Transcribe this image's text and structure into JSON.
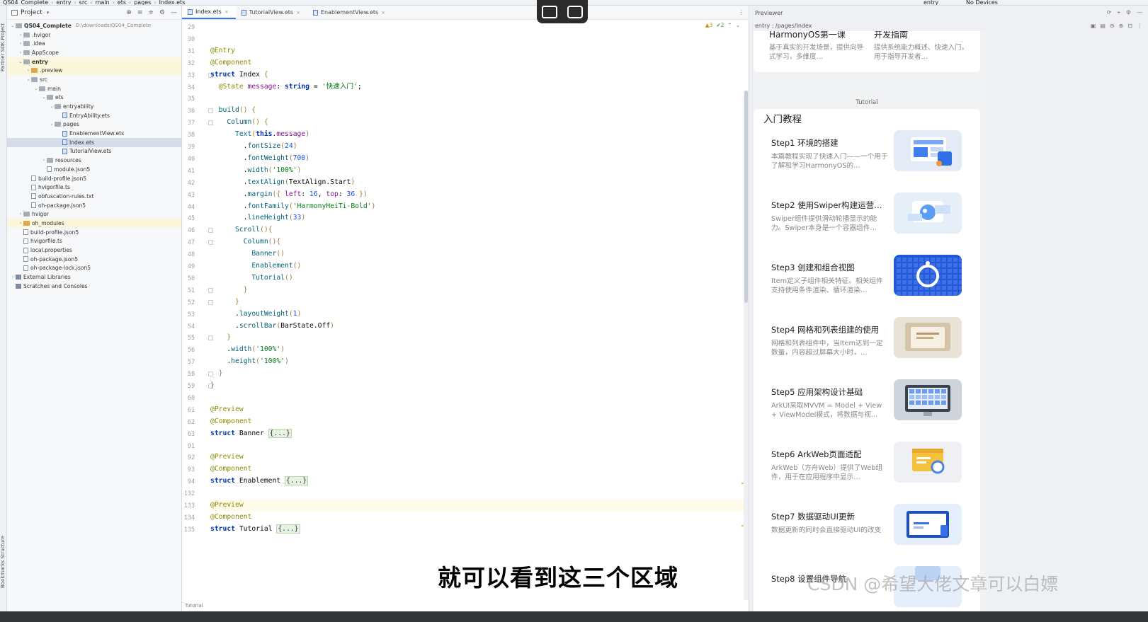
{
  "breadcrumb": [
    "QS04_Complete",
    "entry",
    "src",
    "main",
    "ets",
    "pages",
    "Index.ets"
  ],
  "run_config": {
    "module": "entry",
    "devices": "No Devices"
  },
  "left_strip": {
    "top": "Partner SDK  Project",
    "bottom": "Bookmarks  Structure"
  },
  "project_panel": {
    "title": "Project",
    "tree": [
      {
        "label": "QS04_Complete",
        "hint": "D:\\downloads\\QS04_Complete",
        "depth": 0,
        "arrow": "v",
        "icon": "folder",
        "bold": true
      },
      {
        "label": ".hvigor",
        "depth": 1,
        "arrow": ">",
        "icon": "folder"
      },
      {
        "label": ".idea",
        "depth": 1,
        "arrow": ">",
        "icon": "folder"
      },
      {
        "label": "AppScope",
        "depth": 1,
        "arrow": ">",
        "icon": "folder"
      },
      {
        "label": "entry",
        "depth": 1,
        "arrow": "v",
        "icon": "folder",
        "bold": true,
        "hl": true
      },
      {
        "label": ".preview",
        "depth": 2,
        "arrow": ">",
        "icon": "folder-orange",
        "hl": true
      },
      {
        "label": "src",
        "depth": 2,
        "arrow": "v",
        "icon": "folder"
      },
      {
        "label": "main",
        "depth": 3,
        "arrow": "v",
        "icon": "folder"
      },
      {
        "label": "ets",
        "depth": 4,
        "arrow": "v",
        "icon": "folder"
      },
      {
        "label": "entryability",
        "depth": 5,
        "arrow": "v",
        "icon": "folder"
      },
      {
        "label": "EntryAbility.ets",
        "depth": 6,
        "arrow": "",
        "icon": "ets"
      },
      {
        "label": "pages",
        "depth": 5,
        "arrow": "v",
        "icon": "folder"
      },
      {
        "label": "EnablementView.ets",
        "depth": 6,
        "arrow": "",
        "icon": "ets"
      },
      {
        "label": "Index.ets",
        "depth": 6,
        "arrow": "",
        "icon": "ets",
        "sel": true
      },
      {
        "label": "TutorialView.ets",
        "depth": 6,
        "arrow": "",
        "icon": "ets"
      },
      {
        "label": "resources",
        "depth": 4,
        "arrow": ">",
        "icon": "folder"
      },
      {
        "label": "module.json5",
        "depth": 4,
        "arrow": "",
        "icon": "file"
      },
      {
        "label": "build-profile.json5",
        "depth": 2,
        "arrow": "",
        "icon": "file"
      },
      {
        "label": "hvigorfile.ts",
        "depth": 2,
        "arrow": "",
        "icon": "file"
      },
      {
        "label": "obfuscation-rules.txt",
        "depth": 2,
        "arrow": "",
        "icon": "file"
      },
      {
        "label": "oh-package.json5",
        "depth": 2,
        "arrow": "",
        "icon": "file"
      },
      {
        "label": "hvigor",
        "depth": 1,
        "arrow": ">",
        "icon": "folder"
      },
      {
        "label": "oh_modules",
        "depth": 1,
        "arrow": ">",
        "icon": "folder-orange",
        "hl": true
      },
      {
        "label": "build-profile.json5",
        "depth": 1,
        "arrow": "",
        "icon": "file"
      },
      {
        "label": "hvigorfile.ts",
        "depth": 1,
        "arrow": "",
        "icon": "file"
      },
      {
        "label": "local.properties",
        "depth": 1,
        "arrow": "",
        "icon": "file"
      },
      {
        "label": "oh-package.json5",
        "depth": 1,
        "arrow": "",
        "icon": "file"
      },
      {
        "label": "oh-package-lock.json5",
        "depth": 1,
        "arrow": "",
        "icon": "file"
      },
      {
        "label": "External Libraries",
        "depth": 0,
        "arrow": ">",
        "icon": "lib"
      },
      {
        "label": "Scratches and Consoles",
        "depth": 0,
        "arrow": "",
        "icon": "lib"
      }
    ]
  },
  "editor": {
    "tabs": [
      {
        "label": "Index.ets",
        "active": true
      },
      {
        "label": "TutorialView.ets",
        "active": false
      },
      {
        "label": "EnablementView.ets",
        "active": false
      }
    ],
    "inspections": {
      "warnings": "▲3",
      "ok": "✔2"
    },
    "bottom_crumb": "Tutorial",
    "lines": [
      {
        "n": "29",
        "t": []
      },
      {
        "n": "30",
        "t": []
      },
      {
        "n": "31",
        "t": [
          [
            "ann",
            "@Entry"
          ]
        ]
      },
      {
        "n": "32",
        "t": [
          [
            "ann",
            "@Component"
          ]
        ]
      },
      {
        "n": "33",
        "t": [
          [
            "kw",
            "struct "
          ],
          [
            "id",
            "Index "
          ],
          [
            "br",
            "{"
          ]
        ],
        "fold": true
      },
      {
        "n": "34",
        "t": [
          [
            "id",
            "  "
          ],
          [
            "ann",
            "@State "
          ],
          [
            "prop",
            "message"
          ],
          [
            "id",
            ": "
          ],
          [
            "kw",
            "string "
          ],
          [
            "id",
            "= "
          ],
          [
            "str",
            "'快速入门'"
          ],
          [
            "id",
            ";"
          ]
        ]
      },
      {
        "n": "35",
        "t": []
      },
      {
        "n": "36",
        "t": [
          [
            "id",
            "  "
          ],
          [
            "fn",
            "build"
          ],
          [
            "br",
            "() {"
          ]
        ],
        "fold": true
      },
      {
        "n": "37",
        "t": [
          [
            "id",
            "    "
          ],
          [
            "fn",
            "Column"
          ],
          [
            "br",
            "() {"
          ]
        ],
        "fold": true
      },
      {
        "n": "38",
        "t": [
          [
            "id",
            "      "
          ],
          [
            "fn",
            "Text"
          ],
          [
            "br",
            "("
          ],
          [
            "kw",
            "this"
          ],
          [
            "id",
            "."
          ],
          [
            "prop",
            "message"
          ],
          [
            "br",
            ")"
          ]
        ]
      },
      {
        "n": "39",
        "t": [
          [
            "id",
            "        ."
          ],
          [
            "fn",
            "fontSize"
          ],
          [
            "br",
            "("
          ],
          [
            "num",
            "24"
          ],
          [
            "br",
            ")"
          ]
        ]
      },
      {
        "n": "40",
        "t": [
          [
            "id",
            "        ."
          ],
          [
            "fn",
            "fontWeight"
          ],
          [
            "br",
            "("
          ],
          [
            "num",
            "700"
          ],
          [
            "br",
            ")"
          ]
        ]
      },
      {
        "n": "41",
        "t": [
          [
            "id",
            "        ."
          ],
          [
            "fn",
            "width"
          ],
          [
            "br",
            "("
          ],
          [
            "str",
            "'100%'"
          ],
          [
            "br",
            ")"
          ]
        ]
      },
      {
        "n": "42",
        "t": [
          [
            "id",
            "        ."
          ],
          [
            "fn",
            "textAlign"
          ],
          [
            "br",
            "("
          ],
          [
            "id",
            "TextAlign.Start"
          ],
          [
            "br",
            ")"
          ]
        ]
      },
      {
        "n": "43",
        "t": [
          [
            "id",
            "        ."
          ],
          [
            "fn",
            "margin"
          ],
          [
            "br",
            "({ "
          ],
          [
            "prop",
            "left"
          ],
          [
            "id",
            ": "
          ],
          [
            "num",
            "16"
          ],
          [
            "id",
            ", "
          ],
          [
            "prop",
            "top"
          ],
          [
            "id",
            ": "
          ],
          [
            "num",
            "36 "
          ],
          [
            "br",
            "})"
          ]
        ]
      },
      {
        "n": "44",
        "t": [
          [
            "id",
            "        ."
          ],
          [
            "fn",
            "fontFamily"
          ],
          [
            "br",
            "("
          ],
          [
            "str",
            "'HarmonyHeiTi-Bold'"
          ],
          [
            "br",
            ")"
          ]
        ]
      },
      {
        "n": "45",
        "t": [
          [
            "id",
            "        ."
          ],
          [
            "fn",
            "lineHeight"
          ],
          [
            "br",
            "("
          ],
          [
            "num",
            "33"
          ],
          [
            "br",
            ")"
          ]
        ]
      },
      {
        "n": "46",
        "t": [
          [
            "id",
            "      "
          ],
          [
            "fn",
            "Scroll"
          ],
          [
            "br",
            "(){"
          ]
        ],
        "fold": true
      },
      {
        "n": "47",
        "t": [
          [
            "id",
            "        "
          ],
          [
            "fn",
            "Column"
          ],
          [
            "br",
            "(){"
          ]
        ],
        "fold": true
      },
      {
        "n": "48",
        "t": [
          [
            "id",
            "          "
          ],
          [
            "fn",
            "Banner"
          ],
          [
            "br",
            "()"
          ]
        ]
      },
      {
        "n": "49",
        "t": [
          [
            "id",
            "          "
          ],
          [
            "fn",
            "Enablement"
          ],
          [
            "br",
            "()"
          ]
        ]
      },
      {
        "n": "50",
        "t": [
          [
            "id",
            "          "
          ],
          [
            "fn",
            "Tutorial"
          ],
          [
            "br",
            "()"
          ]
        ]
      },
      {
        "n": "51",
        "t": [
          [
            "id",
            "        "
          ],
          [
            "br",
            "}"
          ]
        ],
        "fold": true
      },
      {
        "n": "52",
        "t": [
          [
            "id",
            "      "
          ],
          [
            "br",
            "}"
          ]
        ],
        "fold": true
      },
      {
        "n": "53",
        "t": [
          [
            "id",
            "      ."
          ],
          [
            "fn",
            "layoutWeight"
          ],
          [
            "br",
            "("
          ],
          [
            "num",
            "1"
          ],
          [
            "br",
            ")"
          ]
        ]
      },
      {
        "n": "54",
        "t": [
          [
            "id",
            "      ."
          ],
          [
            "fn",
            "scrollBar"
          ],
          [
            "br",
            "("
          ],
          [
            "id",
            "BarState.Off"
          ],
          [
            "br",
            ")"
          ]
        ]
      },
      {
        "n": "55",
        "t": [
          [
            "id",
            "    "
          ],
          [
            "br",
            "}"
          ]
        ],
        "fold": true
      },
      {
        "n": "56",
        "t": [
          [
            "id",
            "    ."
          ],
          [
            "fn",
            "width"
          ],
          [
            "br",
            "("
          ],
          [
            "str",
            "'100%'"
          ],
          [
            "br",
            ")"
          ]
        ]
      },
      {
        "n": "57",
        "t": [
          [
            "id",
            "    ."
          ],
          [
            "fn",
            "height"
          ],
          [
            "br",
            "("
          ],
          [
            "str",
            "'100%'"
          ],
          [
            "br",
            ")"
          ]
        ]
      },
      {
        "n": "58",
        "t": [
          [
            "id",
            "  "
          ],
          [
            "br",
            "}"
          ]
        ],
        "fold": true
      },
      {
        "n": "59",
        "t": [
          [
            "br",
            "}"
          ]
        ],
        "fold": true
      },
      {
        "n": "60",
        "t": []
      },
      {
        "n": "61",
        "t": [
          [
            "ann",
            "@Preview"
          ]
        ]
      },
      {
        "n": "62",
        "t": [
          [
            "ann",
            "@Component"
          ]
        ]
      },
      {
        "n": "63",
        "t": [
          [
            "kw",
            "struct "
          ],
          [
            "id",
            "Banner "
          ],
          [
            "fold",
            "{...}"
          ]
        ]
      },
      {
        "n": "91",
        "t": []
      },
      {
        "n": "92",
        "t": [
          [
            "ann",
            "@Preview"
          ]
        ]
      },
      {
        "n": "93",
        "t": [
          [
            "ann",
            "@Component"
          ]
        ]
      },
      {
        "n": "94",
        "t": [
          [
            "kw",
            "struct "
          ],
          [
            "id",
            "Enablement "
          ],
          [
            "fold",
            "{...}"
          ]
        ]
      },
      {
        "n": "132",
        "t": []
      },
      {
        "n": "133",
        "t": [
          [
            "ann",
            "@Preview"
          ]
        ],
        "cur": true
      },
      {
        "n": "134",
        "t": [
          [
            "ann",
            "@Component"
          ]
        ]
      },
      {
        "n": "135",
        "t": [
          [
            "kw",
            "struct "
          ],
          [
            "id",
            "Tutorial "
          ],
          [
            "fold",
            "{...}"
          ]
        ]
      }
    ]
  },
  "previewer": {
    "title": "Previewer",
    "path": "entry : /pages/Index",
    "banner_cards": [
      {
        "title": "HarmonyOS第一课",
        "desc": "基于真实的开发场景，提供向导式学习，多维度…"
      },
      {
        "title": "开发指南",
        "desc": "提供系统能力概述、快速入门，用于指导开发者…"
      }
    ],
    "tutorial_label": "Tutorial",
    "tutorial_title": "入门教程",
    "steps": [
      {
        "title": "Step1 环境的搭建",
        "desc": "本篇教程实现了快速入门——一个用于了解和学习HarmonyOS的…",
        "thumb": "environment"
      },
      {
        "title": "Step2 使用Swiper构建运营…",
        "desc": "Swiper组件提供滑动轮播显示的能力。Swiper本身是一个容器组件…",
        "thumb": "swiper"
      },
      {
        "title": "Step3 创建和组合视图",
        "desc": "Item定义子组件相关特征。相关组件支持使用条件渲染、循环渲染…",
        "thumb": "view"
      },
      {
        "title": "Step4 网格和列表组建的使用",
        "desc": "网格和列表组件中，当Item达到一定数量，内容超过屏幕大小时，…",
        "thumb": "grid"
      },
      {
        "title": "Step5 应用架构设计基础",
        "desc": "ArkUI采取MVVM = Model + View + ViewModel模式，将数据与视…",
        "thumb": "arch"
      },
      {
        "title": "Step6 ArkWeb页面适配",
        "desc": "ArkWeb（方舟Web）提供了Web组件，用于在应用程序中显示…",
        "thumb": "web"
      },
      {
        "title": "Step7 数据驱动UI更新",
        "desc": "数据更新的同时会直接驱动UI的改变",
        "thumb": "data"
      },
      {
        "title": "Step8 设置组件导航",
        "desc": "",
        "thumb": "nav"
      }
    ]
  },
  "subtitle": "就可以看到这三个区域",
  "watermark": "CSDN @希望大佬文章可以白嫖"
}
